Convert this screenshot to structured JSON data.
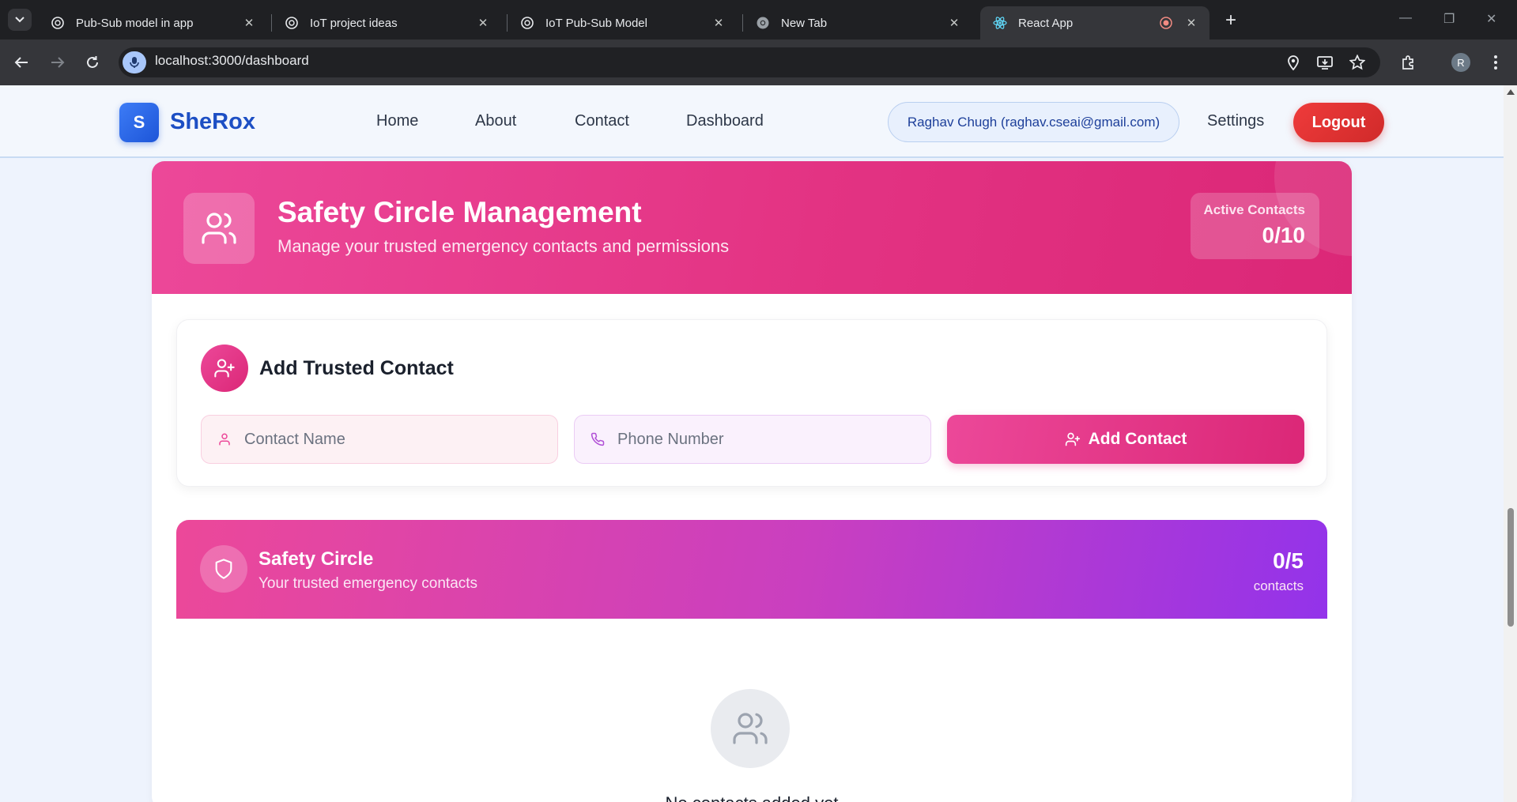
{
  "browser": {
    "tabs": [
      {
        "title": "Pub-Sub model in app",
        "icon": "openai-icon"
      },
      {
        "title": "IoT project ideas",
        "icon": "openai-icon"
      },
      {
        "title": "IoT Pub-Sub Model",
        "icon": "openai-icon"
      },
      {
        "title": "New Tab",
        "icon": "chrome-icon"
      },
      {
        "title": "React App",
        "icon": "react-icon",
        "active": true
      }
    ],
    "url": "localhost:3000/dashboard",
    "profile_initial": "R"
  },
  "nav": {
    "logo_letter": "S",
    "brand": "SheRox",
    "links": [
      "Home",
      "About",
      "Contact",
      "Dashboard"
    ],
    "user": "Raghav Chugh (raghav.cseai@gmail.com)",
    "settings": "Settings",
    "logout": "Logout"
  },
  "hero": {
    "title": "Safety Circle Management",
    "subtitle": "Manage your trusted emergency contacts and permissions",
    "active_label": "Active Contacts",
    "active_value": "0/10"
  },
  "add_contact": {
    "title": "Add Trusted Contact",
    "name_placeholder": "Contact Name",
    "phone_placeholder": "Phone Number",
    "button": "Add Contact"
  },
  "safety_circle": {
    "title": "Safety Circle",
    "subtitle": "Your trusted emergency contacts",
    "count": "0/5",
    "unit": "contacts",
    "empty_text": "No contacts added yet"
  },
  "colors": {
    "brand_blue": "#1d4fc4",
    "pink": "#ec4899",
    "purple": "#9333ea",
    "logout_red": "#e53535"
  }
}
